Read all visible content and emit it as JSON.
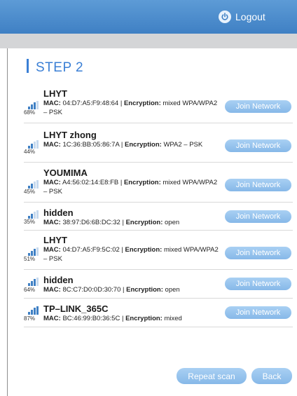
{
  "header": {
    "logout_label": "Logout",
    "logout_icon": "power-icon",
    "accent": "#3f80c4"
  },
  "step": {
    "title": "STEP 2",
    "accent": "#3a7fd5"
  },
  "networks": [
    {
      "ssid": "LHYT",
      "signal": "68%",
      "mac": "04:D7:A5:F9:48:64",
      "encryption": "mixed WPA/WPA2 – PSK",
      "join_label": "Join Network"
    },
    {
      "ssid": "LHYT zhong",
      "signal": "44%",
      "mac": "1C:36:BB:05:86:7A",
      "encryption": "WPA2 – PSK",
      "join_label": "Join Network"
    },
    {
      "ssid": "YOUMIMA",
      "signal": "45%",
      "mac": "A4:56:02:14:E8:FB",
      "encryption": "mixed WPA/WPA2 – PSK",
      "join_label": "Join Network"
    },
    {
      "ssid": "hidden",
      "signal": "35%",
      "mac": "38:97:D6:6B:DC:32",
      "encryption": "open",
      "join_label": "Join Network"
    },
    {
      "ssid": "LHYT",
      "signal": "51%",
      "mac": "04:D7:A5:F9:5C:02",
      "encryption": "mixed WPA/WPA2 – PSK",
      "join_label": "Join Network"
    },
    {
      "ssid": "hidden",
      "signal": "64%",
      "mac": "8C:C7:D0:0D:30:70",
      "encryption": "open",
      "join_label": "Join Network"
    },
    {
      "ssid": "TP–LINK_365C",
      "signal": "87%",
      "mac": "BC:46:99:B0:36:5C",
      "encryption": "mixed",
      "join_label": "Join Network"
    }
  ],
  "labels": {
    "mac": "MAC:",
    "encryption": "Encryption:"
  },
  "actions": {
    "repeat_label": "Repeat scan",
    "back_label": "Back"
  }
}
